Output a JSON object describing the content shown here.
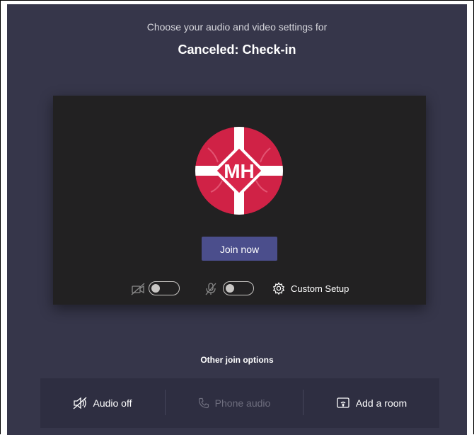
{
  "header": {
    "subtitle": "Choose your audio and video settings for",
    "meeting_title": "Canceled: Check-in"
  },
  "preview": {
    "avatar_initials": "MH",
    "join_label": "Join now",
    "camera_toggle": {
      "state": "off"
    },
    "mic_toggle": {
      "state": "off"
    },
    "custom_setup_label": "Custom Setup"
  },
  "other_options": {
    "title": "Other join options",
    "items": [
      {
        "label": "Audio off",
        "icon": "speaker-off-icon",
        "enabled": true
      },
      {
        "label": "Phone audio",
        "icon": "phone-icon",
        "enabled": false
      },
      {
        "label": "Add a room",
        "icon": "cast-room-icon",
        "enabled": true
      }
    ]
  },
  "colors": {
    "background": "#36364a",
    "preview_bg": "#222122",
    "accent": "#4b4e8c",
    "avatar_red": "#d8264a"
  }
}
